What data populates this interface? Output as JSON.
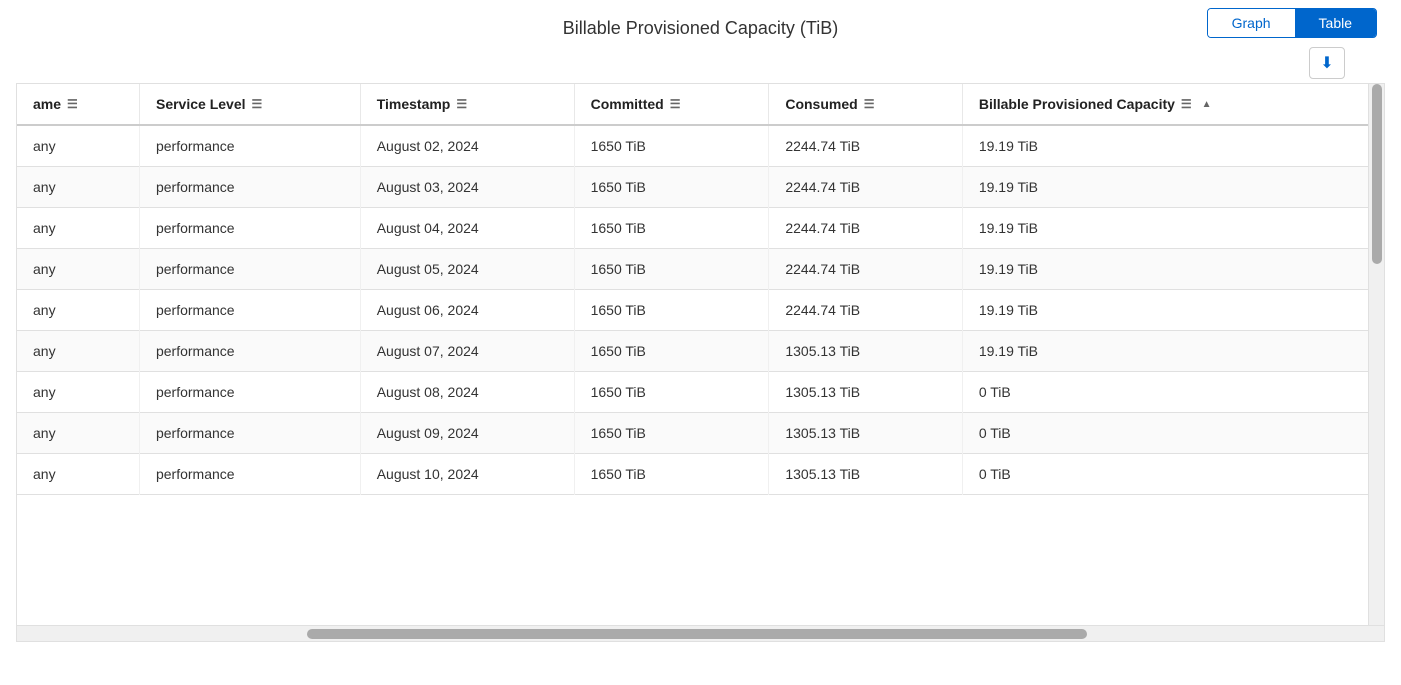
{
  "header": {
    "title": "Billable Provisioned Capacity (TiB)"
  },
  "toggle": {
    "graph_label": "Graph",
    "table_label": "Table",
    "active": "table"
  },
  "toolbar": {
    "download_label": "⬇"
  },
  "table": {
    "columns": [
      {
        "id": "name",
        "label": "ame",
        "filter": true
      },
      {
        "id": "service_level",
        "label": "Service Level",
        "filter": true
      },
      {
        "id": "timestamp",
        "label": "Timestamp",
        "filter": true
      },
      {
        "id": "committed",
        "label": "Committed",
        "filter": true
      },
      {
        "id": "consumed",
        "label": "Consumed",
        "filter": true
      },
      {
        "id": "billable_provisioned_capacity",
        "label": "Billable Provisioned Capacity",
        "filter": true,
        "sort": "desc"
      }
    ],
    "rows": [
      {
        "name": "any",
        "service_level": "performance",
        "timestamp": "August 02, 2024",
        "committed": "1650 TiB",
        "consumed": "2244.74 TiB",
        "billable_provisioned_capacity": "19.19 TiB"
      },
      {
        "name": "any",
        "service_level": "performance",
        "timestamp": "August 03, 2024",
        "committed": "1650 TiB",
        "consumed": "2244.74 TiB",
        "billable_provisioned_capacity": "19.19 TiB"
      },
      {
        "name": "any",
        "service_level": "performance",
        "timestamp": "August 04, 2024",
        "committed": "1650 TiB",
        "consumed": "2244.74 TiB",
        "billable_provisioned_capacity": "19.19 TiB"
      },
      {
        "name": "any",
        "service_level": "performance",
        "timestamp": "August 05, 2024",
        "committed": "1650 TiB",
        "consumed": "2244.74 TiB",
        "billable_provisioned_capacity": "19.19 TiB"
      },
      {
        "name": "any",
        "service_level": "performance",
        "timestamp": "August 06, 2024",
        "committed": "1650 TiB",
        "consumed": "2244.74 TiB",
        "billable_provisioned_capacity": "19.19 TiB"
      },
      {
        "name": "any",
        "service_level": "performance",
        "timestamp": "August 07, 2024",
        "committed": "1650 TiB",
        "consumed": "1305.13 TiB",
        "billable_provisioned_capacity": "19.19 TiB"
      },
      {
        "name": "any",
        "service_level": "performance",
        "timestamp": "August 08, 2024",
        "committed": "1650 TiB",
        "consumed": "1305.13 TiB",
        "billable_provisioned_capacity": "0 TiB"
      },
      {
        "name": "any",
        "service_level": "performance",
        "timestamp": "August 09, 2024",
        "committed": "1650 TiB",
        "consumed": "1305.13 TiB",
        "billable_provisioned_capacity": "0 TiB"
      },
      {
        "name": "any",
        "service_level": "performance",
        "timestamp": "August 10, 2024",
        "committed": "1650 TiB",
        "consumed": "1305.13 TiB",
        "billable_provisioned_capacity": "0 TiB"
      }
    ]
  }
}
